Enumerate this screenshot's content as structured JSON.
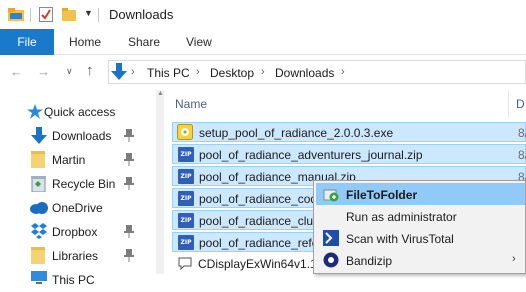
{
  "window": {
    "title": "Downloads"
  },
  "ribbon": {
    "tabs": [
      "File",
      "Home",
      "Share",
      "View"
    ]
  },
  "address": {
    "crumbs": [
      "This PC",
      "Desktop",
      "Downloads"
    ]
  },
  "nav": {
    "items": [
      {
        "label": "Quick access",
        "icon": "star-icon"
      },
      {
        "label": "Downloads",
        "icon": "download-arrow-icon"
      },
      {
        "label": "Martin",
        "icon": "folder-icon"
      },
      {
        "label": "Recycle Bin",
        "icon": "recycle-bin-icon"
      },
      {
        "label": "OneDrive",
        "icon": "cloud-icon"
      },
      {
        "label": "Dropbox",
        "icon": "dropbox-icon"
      },
      {
        "label": "Libraries",
        "icon": "folder-icon"
      },
      {
        "label": "This PC",
        "icon": "computer-icon"
      }
    ]
  },
  "files": {
    "header": {
      "name": "Name",
      "date": "D"
    },
    "rows": [
      {
        "name": "setup_pool_of_radiance_2.0.0.3.exe",
        "date": "8/",
        "selected": true,
        "icon": "installer-icon"
      },
      {
        "name": "pool_of_radiance_adventurers_journal.zip",
        "date": "8/",
        "selected": true,
        "icon": "zip-icon"
      },
      {
        "name": "pool_of_radiance_manual.zip",
        "date": "8/",
        "selected": true,
        "icon": "zip-icon"
      },
      {
        "name": "pool_of_radiance_codewheel.zip",
        "date": "8/",
        "selected": true,
        "icon": "zip-icon"
      },
      {
        "name": "pool_of_radiance_cluebook.zip",
        "date": "8/",
        "selected": true,
        "icon": "zip-icon"
      },
      {
        "name": "pool_of_radiance_reference_card.zip",
        "date": "8/",
        "selected": true,
        "icon": "zip-icon"
      },
      {
        "name": "CDisplayExWin64v1.10.33.zip",
        "date": "8/",
        "selected": false,
        "icon": "zip-icon"
      }
    ]
  },
  "context_menu": {
    "items": [
      {
        "label": "FileToFolder",
        "icon": "file-to-folder-icon",
        "highlighted": true
      },
      {
        "label": "Run as administrator",
        "icon": "",
        "highlighted": false
      },
      {
        "label": "Scan with VirusTotal",
        "icon": "virustotal-icon",
        "highlighted": false
      },
      {
        "label": "Bandizip",
        "icon": "bandizip-icon",
        "highlighted": false
      }
    ]
  },
  "zip_badge": "ZIP",
  "colors": {
    "accent": "#1979ca",
    "selection": "#cce8ff",
    "menu_highlight": "#91c9f7"
  }
}
